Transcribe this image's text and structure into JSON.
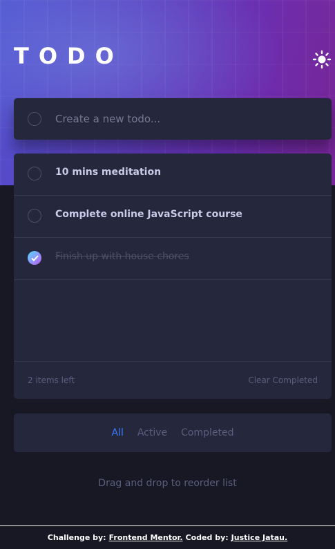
{
  "header": {
    "title": "TODO",
    "theme_icon": "sun-icon"
  },
  "new_todo": {
    "placeholder": "Create a new todo..."
  },
  "todos": [
    {
      "text": "10 mins meditation",
      "completed": false
    },
    {
      "text": "Complete online JavaScript course",
      "completed": false
    },
    {
      "text": "Finish up with house chores",
      "completed": true
    }
  ],
  "list_footer": {
    "items_left": "2 items left",
    "clear_label": "Clear Completed"
  },
  "filters": {
    "all": "All",
    "active": "Active",
    "completed": "Completed",
    "selected": "All"
  },
  "hint": "Drag and drop to reorder list",
  "attribution": {
    "challenge_prefix": "Challenge by:",
    "challenge_link": "Frontend Mentor.",
    "coded_prefix": "Coded by:",
    "coded_link": "Justice Jatau."
  },
  "colors": {
    "accent": "#3a7cfd",
    "card": "#25273d",
    "background": "#171823",
    "check_gradient_start": "#55ddff",
    "check_gradient_end": "#c058f3"
  }
}
